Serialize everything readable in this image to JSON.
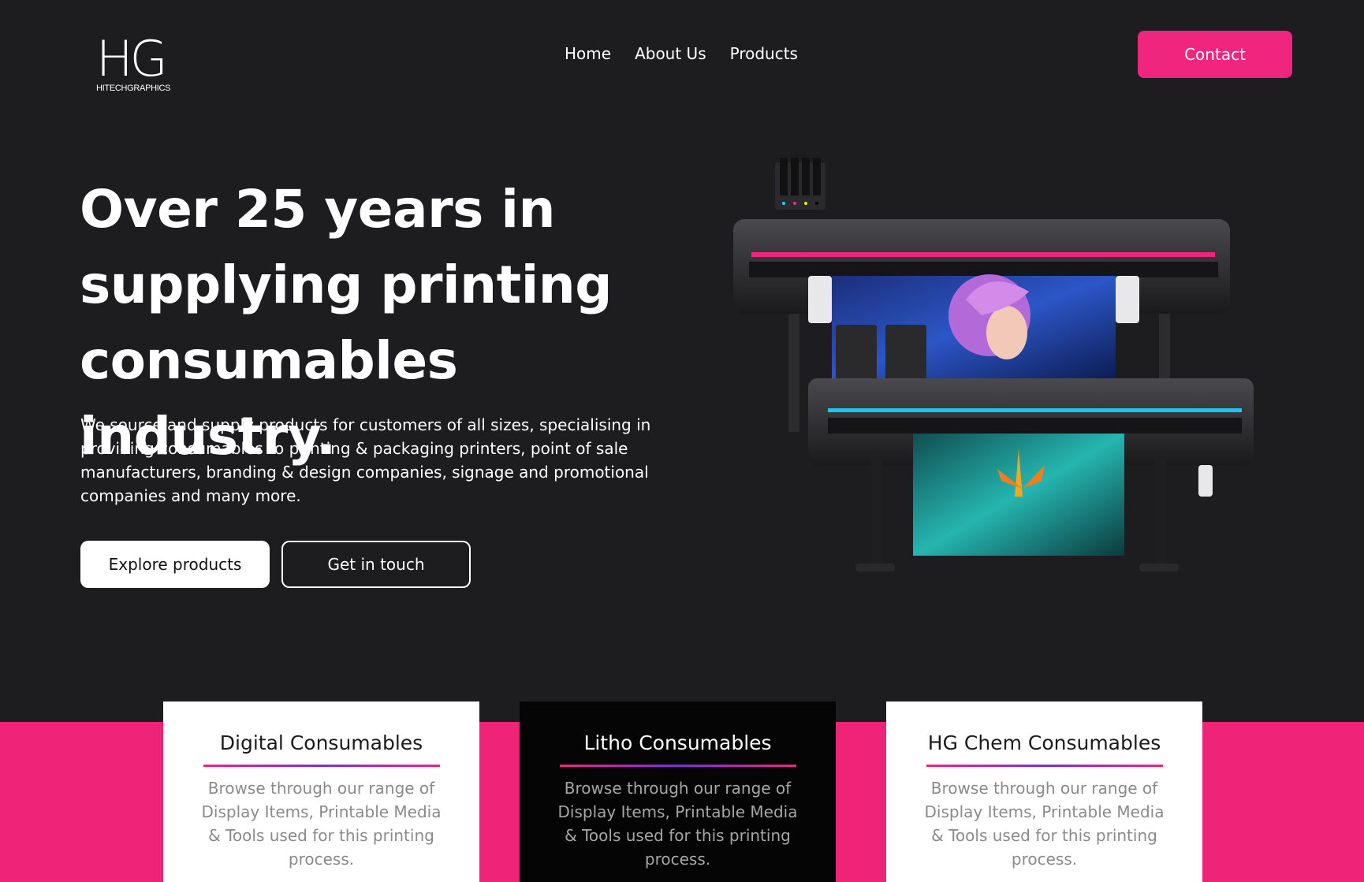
{
  "brand": {
    "logo_mark": "HG",
    "logo_text": "HITECHGRAPHICS"
  },
  "nav": {
    "items": [
      "Home",
      "About Us",
      "Products"
    ],
    "contact_label": "Contact"
  },
  "hero": {
    "title_lines": [
      "Over 25 years in",
      "supplying printing",
      "consumables industry."
    ],
    "description": "We source and supply products for customers of all sizes, specialising in providing consumables to printing & packaging printers, point of sale manufacturers, branding & design companies, signage and promotional companies and many more.",
    "primary_button": "Explore products",
    "secondary_button": "Get in touch"
  },
  "cards": [
    {
      "title": "Digital Consumables",
      "body": "Browse through our range of Display Items, Printable Media & Tools used for this printing process.",
      "theme": "light"
    },
    {
      "title": "Litho Consumables",
      "body": "Browse through our range of Display Items, Printable Media & Tools used for this printing process.",
      "theme": "dark"
    },
    {
      "title": "HG Chem Consumables",
      "body": "Browse through our range of Display Items, Printable Media & Tools used for this printing process.",
      "theme": "light"
    }
  ],
  "colors": {
    "accent": "#f0257d",
    "background": "#1d1c1e",
    "card_dark": "#050505"
  }
}
